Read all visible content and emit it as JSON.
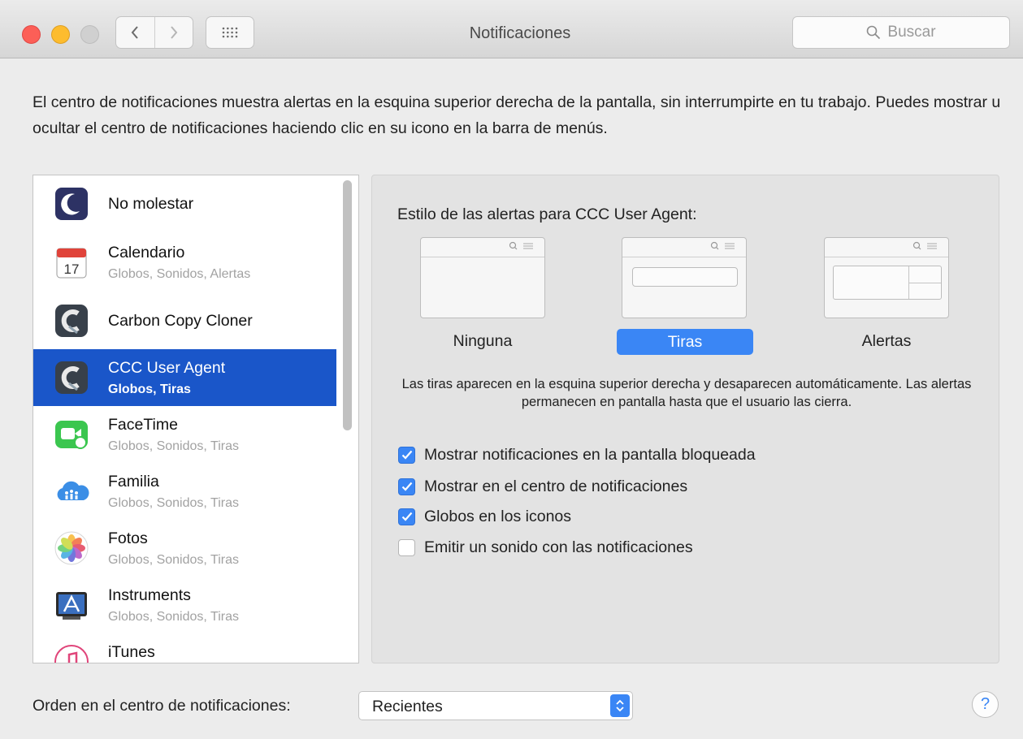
{
  "window": {
    "title": "Notificaciones",
    "search_placeholder": "Buscar"
  },
  "description": "El centro de notificaciones muestra alertas en la esquina superior derecha de la pantalla, sin interrumpirte en tu trabajo. Puedes mostrar u ocultar el centro de notificaciones haciendo clic en su icono en la barra de menús.",
  "apps": [
    {
      "name": "No molestar",
      "subtitle": "",
      "icon": "moon-icon"
    },
    {
      "name": "Calendario",
      "subtitle": "Globos, Sonidos, Alertas",
      "icon": "calendar-icon"
    },
    {
      "name": "Carbon Copy Cloner",
      "subtitle": "",
      "icon": "carbon-copy-cloner-icon"
    },
    {
      "name": "CCC User Agent",
      "subtitle": "Globos, Tiras",
      "icon": "ccc-user-agent-icon",
      "selected": true
    },
    {
      "name": "FaceTime",
      "subtitle": "Globos, Sonidos, Tiras",
      "icon": "facetime-icon"
    },
    {
      "name": "Familia",
      "subtitle": "Globos, Sonidos, Tiras",
      "icon": "family-icon"
    },
    {
      "name": "Fotos",
      "subtitle": "Globos, Sonidos, Tiras",
      "icon": "photos-icon"
    },
    {
      "name": "Instruments",
      "subtitle": "Globos, Sonidos, Tiras",
      "icon": "instruments-icon"
    },
    {
      "name": "iTunes",
      "subtitle": "",
      "icon": "itunes-icon"
    }
  ],
  "alert_style": {
    "title": "Estilo de las alertas para CCC User Agent:",
    "options": [
      "Ninguna",
      "Tiras",
      "Alertas"
    ],
    "selected": "Tiras",
    "explanation": "Las tiras aparecen en la esquina superior derecha y desaparecen automáticamente. Las alertas permanecen en pantalla hasta que el usuario las cierra."
  },
  "options": [
    {
      "label": "Mostrar notificaciones en la pantalla bloqueada",
      "checked": true
    },
    {
      "label": "Mostrar en el centro de notificaciones",
      "checked": true
    },
    {
      "label": "Globos en los iconos",
      "checked": true
    },
    {
      "label": "Emitir un sonido con las notificaciones",
      "checked": false
    }
  ],
  "order": {
    "label": "Orden en el centro de notificaciones:",
    "value": "Recientes"
  },
  "help_label": "?",
  "colors": {
    "selection": "#1a56c9",
    "accent": "#3a86f5"
  }
}
